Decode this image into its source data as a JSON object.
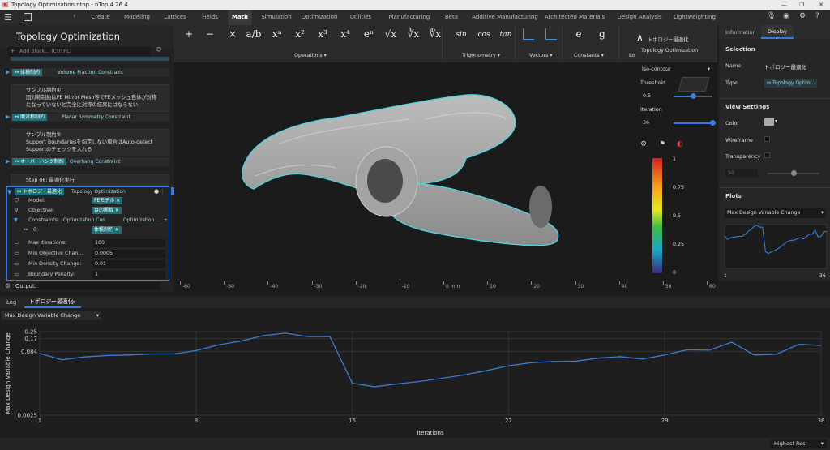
{
  "window": {
    "title": "Topology Optimization.ntop - nTop 4.26.4"
  },
  "menu": {
    "tabs": [
      "Create",
      "Modeling",
      "Lattices",
      "Fields",
      "Math",
      "Simulation",
      "Optimization",
      "Utilities",
      "Manufacturing",
      "Beta",
      "Additive Manufacturing",
      "Architected Materials",
      "Design Analysis",
      "Lightweighting"
    ],
    "active": "Math"
  },
  "notebook": {
    "title": "Topology Optimization",
    "add_block_placeholder": "Add Block... (Ctrl+L)"
  },
  "blocks": {
    "volume": {
      "tag": "体積制約",
      "label": "Volume Fraction Constraint"
    },
    "sample1": {
      "title": "サンプル制約①：",
      "line1": "面対称制約はFE Mirror Mesh等でFEメッシュ自体が対称",
      "line2": "になっていないと完全に対称の結果にはならない"
    },
    "symmetry": {
      "tag": "面対称制約",
      "label": "Planar Symmetry Constraint"
    },
    "sample2": {
      "title": "サンプル制約②",
      "line1": "Support Boundariesを指定しない場合はAuto-detect",
      "line2": "Supportのチェックを入れる"
    },
    "overhang": {
      "tag": "オーバーハング制約",
      "label": "Overhang Constraint"
    },
    "step": {
      "text": "Step 06: 最適化実行"
    },
    "topo": {
      "tag": "トポロジー最適化",
      "label": "Topology Optimization",
      "model_label": "Model:",
      "model_value": "FEモデル",
      "objective_label": "Objective:",
      "objective_value": "目的関数",
      "constraints_label": "Constraints:",
      "constraints_value": "Optimization Con...",
      "constraints_value2": "Optimization ...",
      "c0_label": "0:",
      "c0_value": "体積制約",
      "params": [
        {
          "label": "Max Iterations:",
          "value": "100"
        },
        {
          "label": "Min Objective Chan...",
          "value": "0.0005"
        },
        {
          "label": "Min Density Change:",
          "value": "0.01"
        },
        {
          "label": "Boundary Penalty:",
          "value": "1"
        }
      ]
    }
  },
  "toolbar": {
    "symbols": [
      "+",
      "−",
      "×",
      "a/b",
      "xⁿ",
      "x²",
      "x³",
      "x⁴",
      "eⁿ",
      "√x",
      "∛x",
      "∜x",
      "sin",
      "cos",
      "tan",
      "",
      "",
      "e",
      "g"
    ],
    "groups": {
      "operations": "Operations ▾",
      "trig": "Trigonometry ▾",
      "vectors": "Vectors ▾",
      "constants": "Constants ▾",
      "lo": "Lo"
    }
  },
  "popup": {
    "tag": "トポロジー最適化",
    "title": "Topology Optimization",
    "mode": "Iso-contour",
    "threshold_label": "Threshold",
    "threshold_value": "0.5",
    "iteration_label": "Iteration",
    "iteration_value": "36",
    "threshold_fraction": 0.5,
    "iteration_fraction": 1.0
  },
  "colorbar": {
    "ticks": [
      "1",
      "0.75",
      "0.5",
      "0.25",
      "0"
    ]
  },
  "ruler": {
    "ticks": [
      "-60",
      "-50",
      "-40",
      "-30",
      "-20",
      "-10",
      "0 mm",
      "10",
      "20",
      "30",
      "40",
      "50",
      "60"
    ]
  },
  "right": {
    "tabs": [
      "Information",
      "Display"
    ],
    "active_tab": "Display",
    "selection_title": "Selection",
    "name_label": "Name",
    "name_value": "トポロジー最適化",
    "type_label": "Type",
    "type_value": "Topology Optim...",
    "view_title": "View Settings",
    "color_label": "Color",
    "wireframe_label": "Wireframe",
    "transparency_label": "Transparency",
    "transparency_value": "50",
    "transparency_fraction": 0.5,
    "plots_title": "Plots",
    "plot_select": "Max Design Variable Change",
    "plot_min": "1",
    "plot_max": "36"
  },
  "output": {
    "label": "Output:"
  },
  "logtabs": {
    "log": "Log",
    "topo": "トポロジー最適化"
  },
  "chart_select": "Max Design Variable Change",
  "status": {
    "graphics": "Highest Res"
  },
  "colors": {
    "accent": "#3a7bd5",
    "teal": "#1f6f78",
    "outline": "#4fd3e0"
  },
  "chart_data": {
    "type": "line",
    "title": "",
    "xlabel": "Iterations",
    "ylabel": "Max Design Variable Change",
    "yscale": "log",
    "xlim": [
      1,
      36
    ],
    "ylim": [
      0.0025,
      0.25
    ],
    "xticks": [
      "1",
      "8",
      "15",
      "22",
      "29",
      "36"
    ],
    "yticks": [
      "0.25",
      "0.17",
      "0.084",
      "0.0025"
    ],
    "x": [
      1,
      2,
      3,
      4,
      5,
      6,
      7,
      8,
      9,
      10,
      11,
      12,
      13,
      14,
      15,
      16,
      17,
      18,
      19,
      20,
      21,
      22,
      23,
      24,
      25,
      26,
      27,
      28,
      29,
      30,
      31,
      32,
      33,
      34,
      35,
      36
    ],
    "y": [
      0.075,
      0.053,
      0.062,
      0.067,
      0.069,
      0.073,
      0.073,
      0.088,
      0.12,
      0.148,
      0.2,
      0.23,
      0.19,
      0.19,
      0.0145,
      0.012,
      0.014,
      0.016,
      0.019,
      0.023,
      0.029,
      0.038,
      0.045,
      0.048,
      0.049,
      0.058,
      0.063,
      0.055,
      0.069,
      0.092,
      0.09,
      0.14,
      0.069,
      0.072,
      0.124,
      0.117
    ]
  }
}
